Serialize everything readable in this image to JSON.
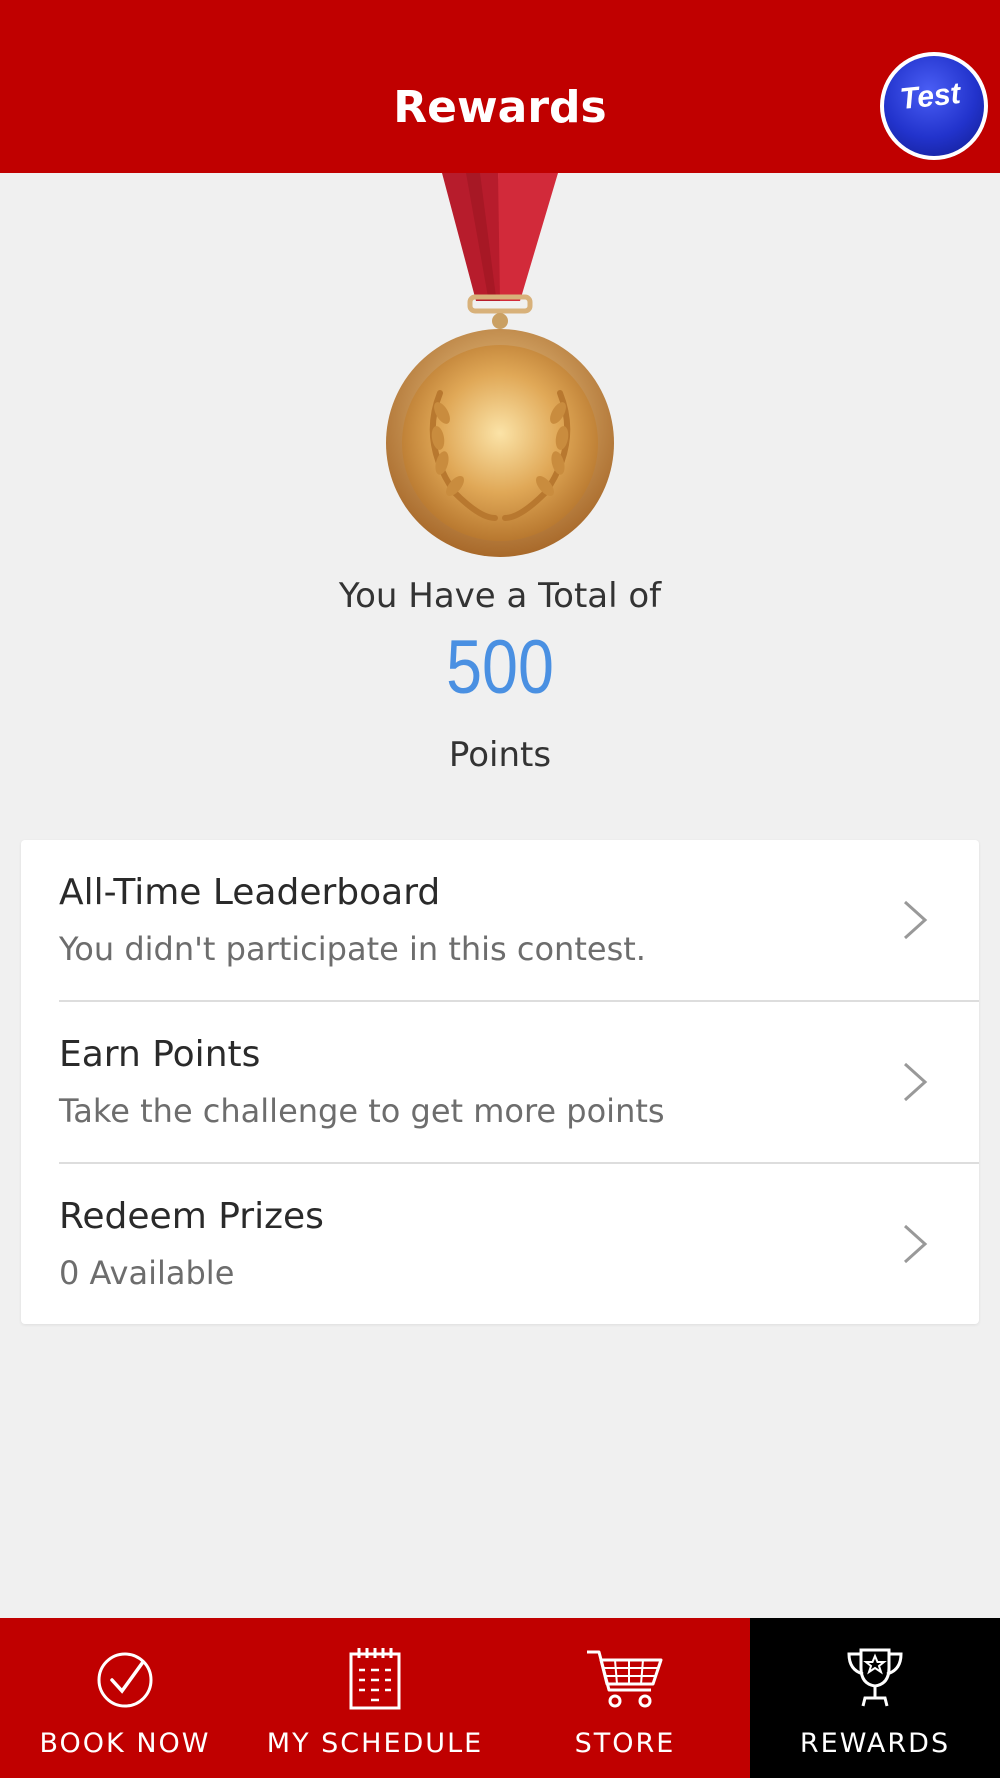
{
  "header": {
    "title": "Rewards",
    "avatar_text": "Test"
  },
  "summary": {
    "total_label": "You Have a Total of",
    "points": "500",
    "points_label": "Points"
  },
  "menu": [
    {
      "title": "All-Time Leaderboard",
      "subtitle": "You didn't participate in this contest."
    },
    {
      "title": "Earn Points",
      "subtitle": "Take the challenge to get more points"
    },
    {
      "title": "Redeem Prizes",
      "subtitle": "0 Available"
    }
  ],
  "tabs": [
    {
      "label": "BOOK NOW",
      "icon": "check-circle-icon"
    },
    {
      "label": "MY SCHEDULE",
      "icon": "calendar-icon"
    },
    {
      "label": "STORE",
      "icon": "cart-icon"
    },
    {
      "label": "REWARDS",
      "icon": "trophy-icon",
      "active": true
    }
  ],
  "colors": {
    "brand_red": "#c00000",
    "points_blue": "#4a90e2",
    "active_tab": "#000000"
  }
}
